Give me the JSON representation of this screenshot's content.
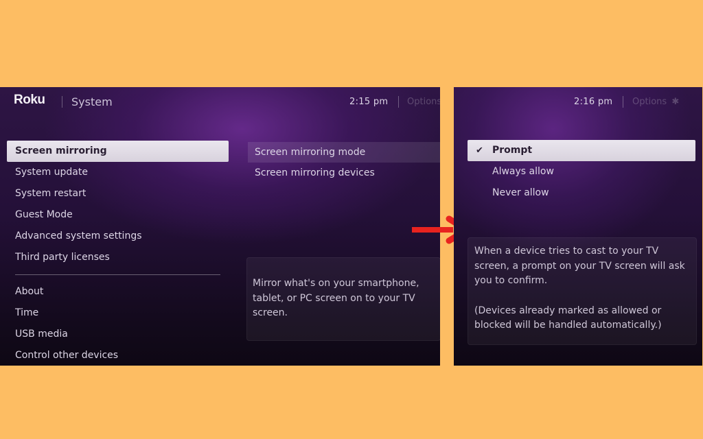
{
  "left_screen": {
    "brand": "Roku",
    "section_title": "System",
    "time": "2:15  pm",
    "options_label": "Options",
    "nav_items_primary": [
      {
        "label": "Screen mirroring",
        "selected": true
      },
      {
        "label": "System update"
      },
      {
        "label": "System restart"
      },
      {
        "label": "Guest Mode"
      },
      {
        "label": "Advanced system settings"
      },
      {
        "label": "Third party licenses"
      }
    ],
    "nav_items_secondary": [
      {
        "label": "About"
      },
      {
        "label": "Time"
      },
      {
        "label": "USB media"
      },
      {
        "label": "Control other devices"
      }
    ],
    "submenu": [
      {
        "label": "Screen mirroring mode",
        "focused": true
      },
      {
        "label": "Screen mirroring devices"
      }
    ],
    "description": "Mirror what's on your smartphone, tablet, or PC screen on to your TV screen."
  },
  "arrow": {
    "icon": "arrow-right-icon",
    "color": "#e8231f"
  },
  "right_screen": {
    "time": "2:16  pm",
    "options_label": "Options",
    "options_icon": "asterisk-icon",
    "mode_options": [
      {
        "label": "Prompt",
        "selected": true,
        "checked": true
      },
      {
        "label": "Always allow"
      },
      {
        "label": "Never allow"
      }
    ],
    "description_main": "When a device tries to cast to your TV screen, a prompt on your TV screen will ask you to confirm.",
    "description_note": "(Devices already marked as allowed or blocked will be handled automatically.)"
  },
  "colors": {
    "page_background": "#fdbd63",
    "screen_purple": "#2e1545",
    "highlight": "#e4e0e8",
    "arrow_red": "#e8231f"
  }
}
